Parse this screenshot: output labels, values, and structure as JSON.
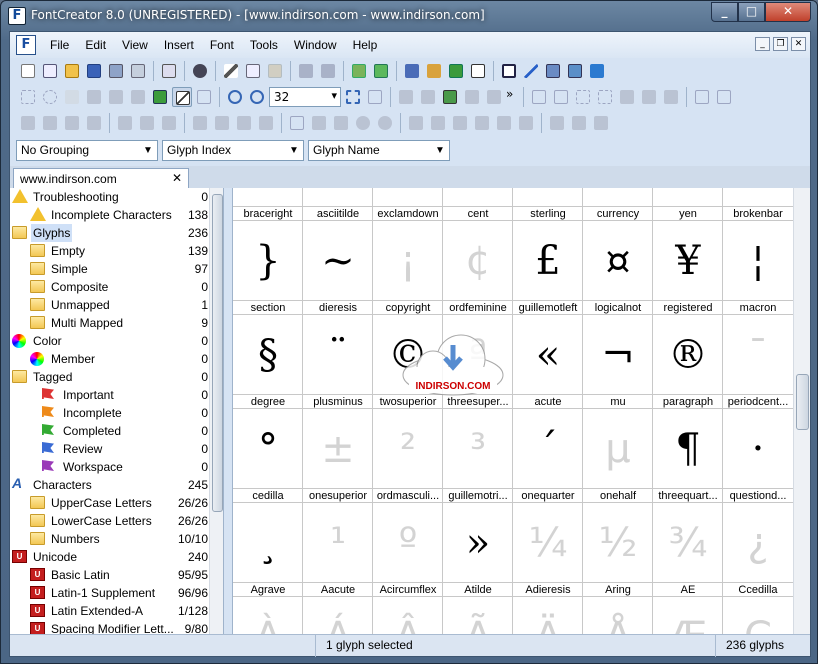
{
  "window": {
    "title": "FontCreator 8.0 (UNREGISTERED) - [www.indirson.com - www.indirson.com]"
  },
  "menu": [
    "File",
    "Edit",
    "View",
    "Insert",
    "Font",
    "Tools",
    "Window",
    "Help"
  ],
  "toolbar": {
    "zoom_value": "32"
  },
  "groupbar": {
    "grouping": "No Grouping",
    "sort1": "Glyph Index",
    "sort2": "Glyph Name"
  },
  "tab": {
    "title": "www.indirson.com"
  },
  "tree": [
    {
      "label": "Troubleshooting",
      "count": "0",
      "indent": 0,
      "icon": "warning-icon"
    },
    {
      "label": "Incomplete Characters",
      "count": "138",
      "indent": 1,
      "icon": "warning-icon"
    },
    {
      "label": "Glyphs",
      "count": "236",
      "indent": 0,
      "icon": "folder-icon",
      "selected": true
    },
    {
      "label": "Empty",
      "count": "139",
      "indent": 1,
      "icon": "folder-icon"
    },
    {
      "label": "Simple",
      "count": "97",
      "indent": 1,
      "icon": "folder-icon"
    },
    {
      "label": "Composite",
      "count": "0",
      "indent": 1,
      "icon": "folder-icon"
    },
    {
      "label": "Unmapped",
      "count": "1",
      "indent": 1,
      "icon": "folder-icon"
    },
    {
      "label": "Multi Mapped",
      "count": "9",
      "indent": 1,
      "icon": "folder-icon"
    },
    {
      "label": "Color",
      "count": "0",
      "indent": 0,
      "icon": "color-wheel-icon"
    },
    {
      "label": "Member",
      "count": "0",
      "indent": 1,
      "icon": "color-wheel-icon"
    },
    {
      "label": "Tagged",
      "count": "0",
      "indent": 0,
      "icon": "folder-icon"
    },
    {
      "label": "Important",
      "count": "0",
      "indent": 1,
      "icon": "flag-red-icon"
    },
    {
      "label": "Incomplete",
      "count": "0",
      "indent": 1,
      "icon": "flag-orange-icon"
    },
    {
      "label": "Completed",
      "count": "0",
      "indent": 1,
      "icon": "flag-green-icon"
    },
    {
      "label": "Review",
      "count": "0",
      "indent": 1,
      "icon": "flag-blue-icon"
    },
    {
      "label": "Workspace",
      "count": "0",
      "indent": 1,
      "icon": "flag-purple-icon"
    },
    {
      "label": "Characters",
      "count": "245",
      "indent": 0,
      "icon": "character-a-icon"
    },
    {
      "label": "UpperCase Letters",
      "count": "26/26",
      "indent": 1,
      "icon": "folder-icon"
    },
    {
      "label": "LowerCase Letters",
      "count": "26/26",
      "indent": 1,
      "icon": "folder-icon"
    },
    {
      "label": "Numbers",
      "count": "10/10",
      "indent": 1,
      "icon": "folder-icon"
    },
    {
      "label": "Unicode",
      "count": "240",
      "indent": 0,
      "icon": "unicode-icon"
    },
    {
      "label": "Basic Latin",
      "count": "95/95",
      "indent": 1,
      "icon": "unicode-icon"
    },
    {
      "label": "Latin-1 Supplement",
      "count": "96/96",
      "indent": 1,
      "icon": "unicode-icon"
    },
    {
      "label": "Latin Extended-A",
      "count": "1/128",
      "indent": 1,
      "icon": "unicode-icon"
    },
    {
      "label": "Spacing Modifier Lett...",
      "count": "9/80",
      "indent": 1,
      "icon": "unicode-icon"
    }
  ],
  "grid": {
    "rows": [
      {
        "glyphs": [
          "¤",
          "~",
          "¡",
          "¢",
          "£",
          "{",
          "¥",
          "¦"
        ],
        "grey": [
          1,
          1,
          1,
          1,
          1,
          1,
          0,
          0
        ],
        "names": [
          "braceright",
          "asciitilde",
          "exclamdown",
          "cent",
          "sterling",
          "currency",
          "yen",
          "brokenbar"
        ],
        "partial": true
      },
      {
        "glyphs": [
          "}",
          "~",
          "¡",
          "¢",
          "£",
          "¤",
          "¥",
          "¦"
        ],
        "grey": [
          0,
          0,
          1,
          1,
          0,
          0,
          0,
          0
        ],
        "names": [
          "section",
          "dieresis",
          "copyright",
          "ordfeminine",
          "guillemotleft",
          "logicalnot",
          "registered",
          "macron"
        ]
      },
      {
        "glyphs": [
          "§",
          "¨",
          "©",
          "ª",
          "«",
          "¬",
          "®",
          "¯"
        ],
        "grey": [
          0,
          0,
          0,
          1,
          0,
          0,
          0,
          1
        ],
        "names": [
          "degree",
          "plusminus",
          "twosuperior",
          "threesuper...",
          "acute",
          "mu",
          "paragraph",
          "periodcent..."
        ]
      },
      {
        "glyphs": [
          "°",
          "±",
          "²",
          "³",
          "´",
          "µ",
          "¶",
          "·"
        ],
        "grey": [
          0,
          1,
          1,
          1,
          0,
          1,
          0,
          0
        ],
        "names": [
          "cedilla",
          "onesuperior",
          "ordmasculi...",
          "guillemotri...",
          "onequarter",
          "onehalf",
          "threequart...",
          "questiond..."
        ]
      },
      {
        "glyphs": [
          "¸",
          "¹",
          "º",
          "»",
          "¼",
          "½",
          "¾",
          "¿"
        ],
        "grey": [
          0,
          1,
          1,
          0,
          1,
          1,
          1,
          1
        ],
        "names": [
          "Agrave",
          "Aacute",
          "Acircumflex",
          "Atilde",
          "Adieresis",
          "Aring",
          "AE",
          "Ccedilla"
        ]
      },
      {
        "glyphs": [
          "À",
          "Á",
          "Â",
          "Ã",
          "Ä",
          "Å",
          "Æ",
          "Ç"
        ],
        "grey": [
          1,
          1,
          1,
          1,
          1,
          1,
          1,
          1
        ],
        "names": []
      }
    ]
  },
  "watermark": {
    "text": "INDIRSON.COM"
  },
  "status": {
    "selection": "1 glyph selected",
    "count": "236 glyphs"
  }
}
